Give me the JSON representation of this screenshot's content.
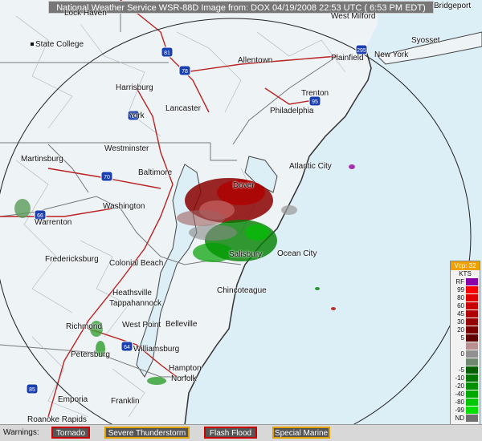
{
  "title_bar": "National Weather Service WSR-88D Image from: DOX 04/19/2008 22:53 UTC ( 6:53 PM EDT)",
  "cities": [
    {
      "name": "State College",
      "marker": true
    },
    {
      "name": "Allentown",
      "marker": false
    },
    {
      "name": "Plainfield",
      "marker": false
    },
    {
      "name": "New York",
      "marker": false
    },
    {
      "name": "Syosset",
      "marker": false
    },
    {
      "name": "Bridgeport",
      "marker": false
    },
    {
      "name": "West Milford",
      "marker": false
    },
    {
      "name": "Harrisburg",
      "marker": false
    },
    {
      "name": "Trenton",
      "marker": false
    },
    {
      "name": "Lancaster",
      "marker": false
    },
    {
      "name": "Philadelphia",
      "marker": false
    },
    {
      "name": "York",
      "marker": false
    },
    {
      "name": "Westminster",
      "marker": false
    },
    {
      "name": "Martinsburg",
      "marker": false
    },
    {
      "name": "Baltimore",
      "marker": false
    },
    {
      "name": "Dover",
      "marker": false
    },
    {
      "name": "Atlantic City",
      "marker": false
    },
    {
      "name": "Washington",
      "marker": false
    },
    {
      "name": "Warrenton",
      "marker": false
    },
    {
      "name": "Fredericksburg",
      "marker": false
    },
    {
      "name": "Colonial Beach",
      "marker": false
    },
    {
      "name": "Salisbury",
      "marker": false
    },
    {
      "name": "Ocean City",
      "marker": false
    },
    {
      "name": "Heathsville",
      "marker": false
    },
    {
      "name": "Tappahannock",
      "marker": false
    },
    {
      "name": "Chincoteague",
      "marker": false
    },
    {
      "name": "Richmond",
      "marker": false
    },
    {
      "name": "West Point",
      "marker": false
    },
    {
      "name": "Belleville",
      "marker": false
    },
    {
      "name": "Petersburg",
      "marker": false
    },
    {
      "name": "Williamsburg",
      "marker": false
    },
    {
      "name": "Hampton",
      "marker": false
    },
    {
      "name": "Norfolk",
      "marker": false
    },
    {
      "name": "Emporia",
      "marker": false
    },
    {
      "name": "Franklin",
      "marker": false
    },
    {
      "name": "Roanoke Rapids",
      "marker": false
    },
    {
      "name": "Lock Haven",
      "marker": false
    }
  ],
  "highways": [
    "81",
    "78",
    "83",
    "95",
    "70",
    "66",
    "64",
    "85",
    "295"
  ],
  "legend": {
    "vcp": "Vcp: 32",
    "units": "KTS",
    "rows": [
      {
        "label": "RF",
        "color": "#8a00a8"
      },
      {
        "label": "99",
        "color": "#ff0000"
      },
      {
        "label": "80",
        "color": "#e00000"
      },
      {
        "label": "60",
        "color": "#c80000"
      },
      {
        "label": "45",
        "color": "#b00000"
      },
      {
        "label": "30",
        "color": "#960000"
      },
      {
        "label": "20",
        "color": "#7a0000"
      },
      {
        "label": "5",
        "color": "#600000"
      },
      {
        "label": "",
        "color": "#b89090"
      },
      {
        "label": "0",
        "color": "#909090"
      },
      {
        "label": "",
        "color": "#708870"
      },
      {
        "label": "-5",
        "color": "#006000"
      },
      {
        "label": "-10",
        "color": "#007800"
      },
      {
        "label": "-20",
        "color": "#009000"
      },
      {
        "label": "-40",
        "color": "#00a800"
      },
      {
        "label": "-80",
        "color": "#00c800"
      },
      {
        "label": "-99",
        "color": "#00e000"
      },
      {
        "label": "ND",
        "color": "#707070"
      }
    ]
  },
  "warnings": {
    "label": "Warnings:",
    "items": [
      {
        "text": "Tornado",
        "border": "#cc0000"
      },
      {
        "text": "Severe Thunderstorm",
        "border": "#e0a000"
      },
      {
        "text": "Flash Flood",
        "border": "#cc0000"
      },
      {
        "text": "Special Marine",
        "border": "#e0a000"
      }
    ]
  }
}
